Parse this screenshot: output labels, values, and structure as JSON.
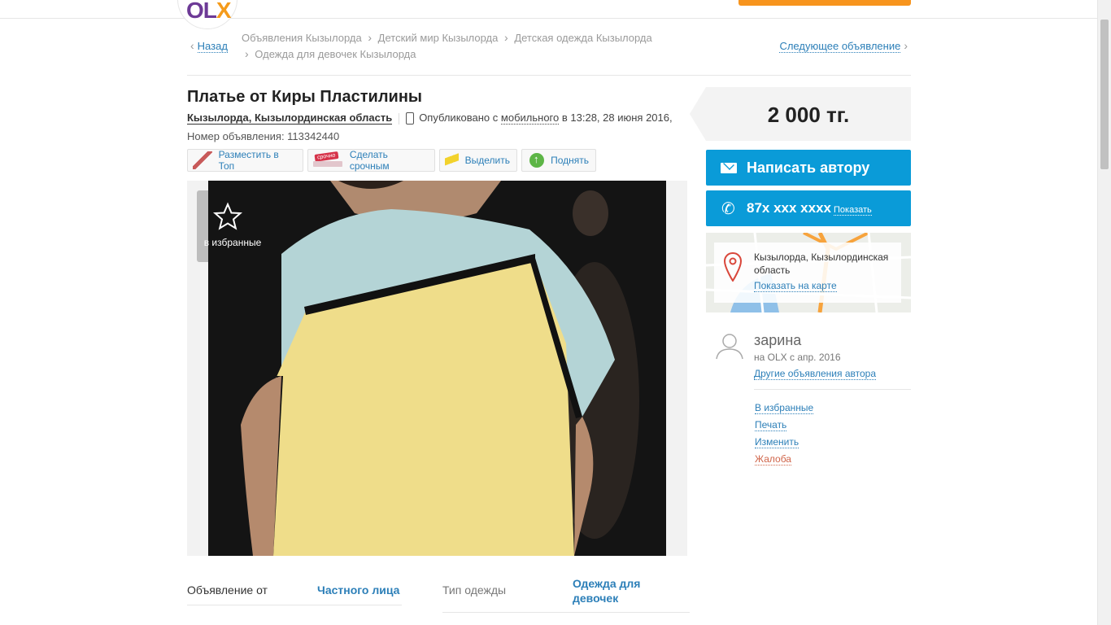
{
  "header": {
    "logo_text_o": "O",
    "logo_text_l": "L",
    "logo_text_x": "X"
  },
  "breadcrumb": {
    "back_label": "Назад",
    "items": [
      "Объявления Кызылорда",
      "Детский мир Кызылорда",
      "Детская одежда Кызылорда",
      "Одежда для девочек Кызылорда"
    ],
    "next_label": "Следующее объявление"
  },
  "ad": {
    "title": "Платье от Киры Пластилины",
    "location": "Кызылорда, Кызылординская область",
    "published_prefix": "Опубликовано с",
    "published_mobile": "мобильного",
    "published_suffix": "в 13:28, 28 июня 2016,",
    "ad_number": "Номер объявления: 113342440"
  },
  "promo": {
    "top_label": "Разместить в Топ",
    "urgent_label": "Сделать срочным",
    "highlight_label": "Выделить",
    "raise_label": "Поднять"
  },
  "gallery": {
    "favorite_label": "в избранные"
  },
  "params": [
    {
      "label": "Объявление от",
      "value": "Частного лица"
    },
    {
      "label": "Тип одежды",
      "value": "Одежда для девочек"
    }
  ],
  "sidebar": {
    "price": "2 000 тг.",
    "write_label": "Написать автору",
    "phone": "87x xxx xxxx",
    "show_label": "Показать",
    "map_address": "Кызылорда, Кызылординская область",
    "map_link": "Показать на карте",
    "user_name": "зарина",
    "user_since": "на OLX с апр. 2016",
    "other_ads": "Другие объявления автора",
    "actions": {
      "favorites": "В избранные",
      "print": "Печать",
      "edit": "Изменить",
      "complain": "Жалоба"
    }
  },
  "colors": {
    "accent_blue": "#0a9bd8",
    "link_blue": "#2c7fb8",
    "brand_orange": "#f7941d",
    "brand_purple": "#6d3a96"
  }
}
